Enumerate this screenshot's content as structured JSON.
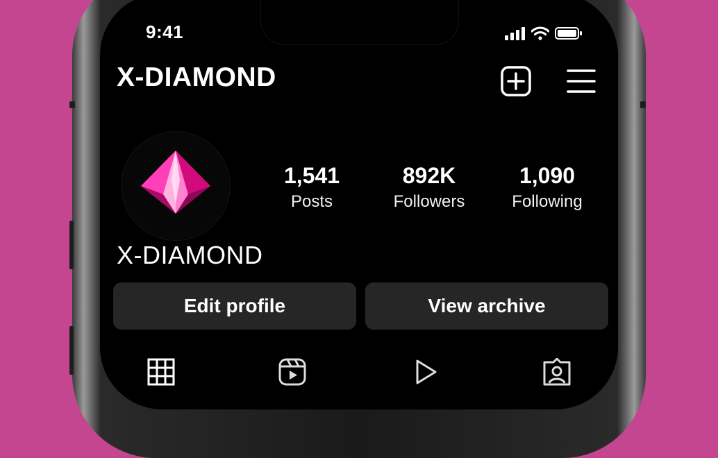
{
  "status_bar": {
    "time": "9:41"
  },
  "header": {
    "title": "X-DIAMOND",
    "icons": [
      "plus-square-icon",
      "menu-icon"
    ]
  },
  "profile": {
    "avatar": "pink-diamond-logo",
    "name": "X-DIAMOND",
    "stats": [
      {
        "value": "1,541",
        "label": "Posts"
      },
      {
        "value": "892K",
        "label": "Followers"
      },
      {
        "value": "1,090",
        "label": "Following"
      }
    ]
  },
  "actions": {
    "edit_profile": "Edit profile",
    "view_archive": "View archive"
  },
  "tabs": [
    "grid-icon",
    "reels-icon",
    "play-icon",
    "tagged-icon"
  ],
  "colors": {
    "background": "#c54690",
    "screen": "#000000",
    "button": "#262626",
    "diamond_accent": "#ff2fb4"
  }
}
